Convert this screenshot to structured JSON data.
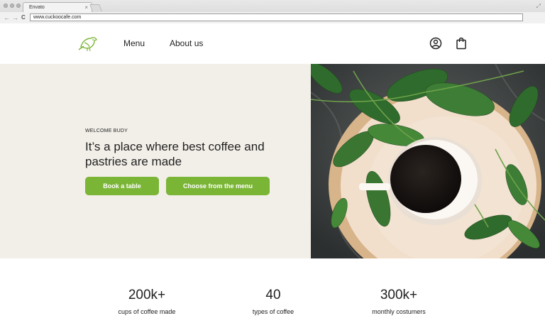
{
  "browser": {
    "tab_title": "Envato",
    "tab_close": "×",
    "url": "www.cuckoocafe.com",
    "back": "←",
    "forward": "→",
    "reload": "C"
  },
  "header": {
    "nav": [
      {
        "label": "Menu"
      },
      {
        "label": "About us"
      }
    ]
  },
  "hero": {
    "eyebrow": "WELCOME BUDY",
    "headline": "It’s a place where best coffee and pastries are made",
    "buttons": [
      {
        "label": "Book a table"
      },
      {
        "label": "Choose from the menu"
      }
    ]
  },
  "stats": [
    {
      "value": "200k+",
      "label": "cups of coffee made"
    },
    {
      "value": "40",
      "label": "types of coffee"
    },
    {
      "value": "300k+",
      "label": "monthly costumers"
    }
  ],
  "colors": {
    "accent": "#7ab535",
    "hero_bg": "#f2efe8"
  },
  "icons": {
    "logo": "bird-logo-icon",
    "account": "user-circle-icon",
    "cart": "shopping-bag-icon"
  }
}
